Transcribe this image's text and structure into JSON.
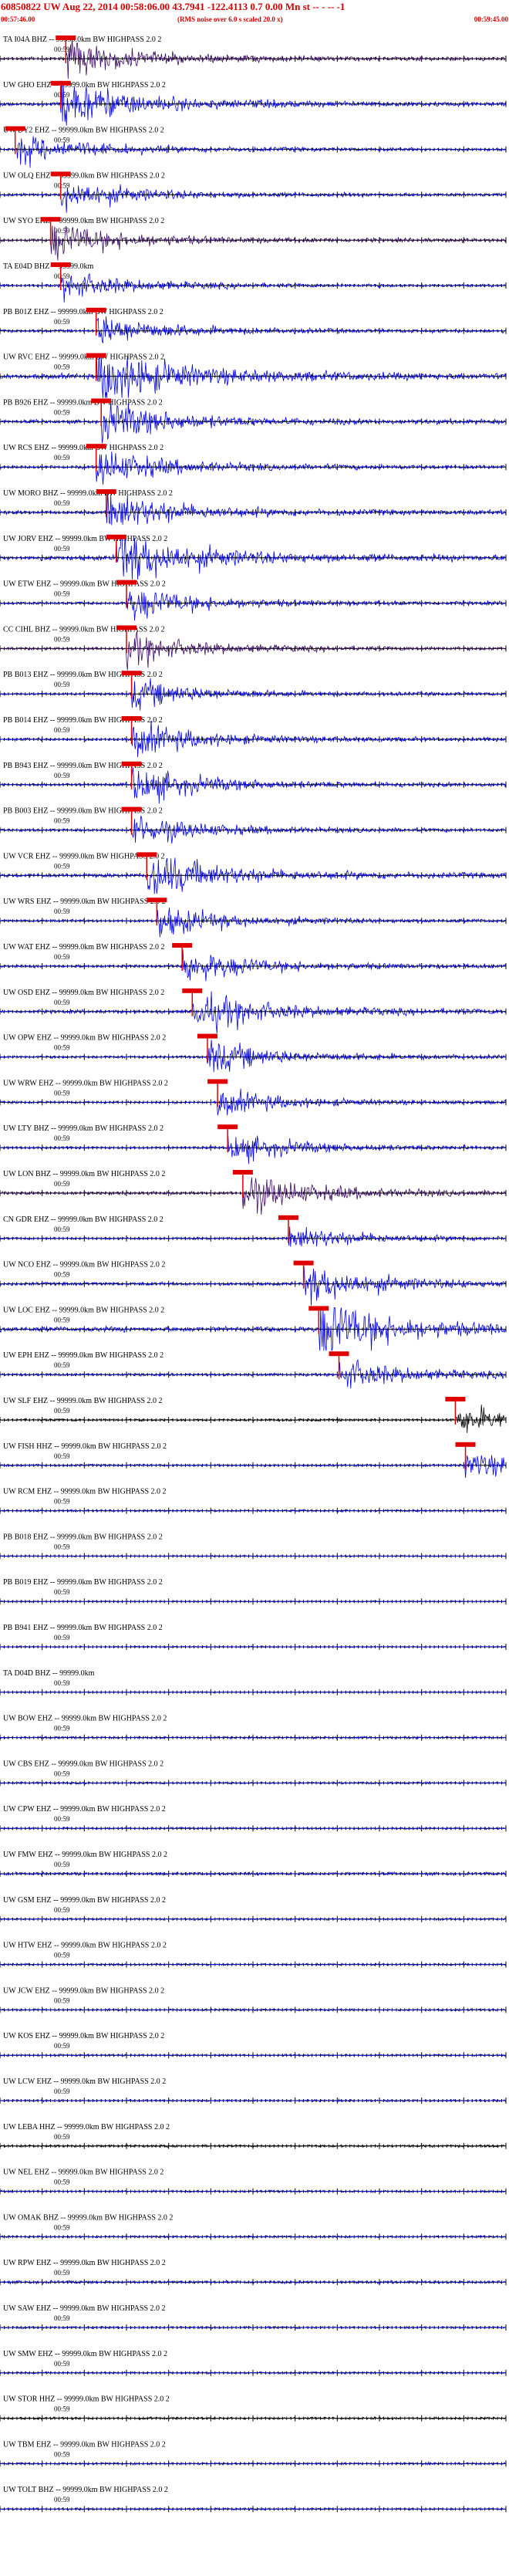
{
  "header": {
    "title": "60850822 UW Aug 22, 2014 00:58:06.00   43.7941 -122.4113  0.7 0.00 Mn st -- - -- -1",
    "start_time": "00:57:46.00",
    "note": "(RMS noise over 6.0 s scaled 20.0 x)",
    "end_time": "00:59:45.00"
  },
  "colors": {
    "red": "#d40000",
    "pick": "#e00000",
    "blue": "#0000ee",
    "purple": "#3a0a66",
    "black": "#000000"
  },
  "chart_data": {
    "type": "line",
    "title": "",
    "x": {
      "start": "00:57:46.00",
      "end": "00:59:45.00",
      "minute_mark": "00:59"
    },
    "traces": [
      {
        "label": "TA I04A BHZ -- 99999.0km BW  HIGHPASS  2.0  2",
        "color": "purple",
        "pick": 0.13,
        "energy": 1.4
      },
      {
        "label": "UW GHO EHZ -- 99999.0km BW  HIGHPASS  2.0  2",
        "color": "blue",
        "pick": 0.12,
        "energy": 1.8
      },
      {
        "label": "UW DY2 EHZ -- 99999.0km BW  HIGHPASS  2.0  2",
        "color": "blue",
        "pick": 0.03,
        "energy": 1.2
      },
      {
        "label": "UW OLQ EHZ -- 99999.0km BW  HIGHPASS  2.0  2",
        "color": "blue",
        "pick": 0.12,
        "energy": 1.2
      },
      {
        "label": "UW SYO EHZ -- 99999.0km BW  HIGHPASS  2.0  2",
        "color": "purple",
        "pick": 0.1,
        "energy": 1.4
      },
      {
        "label": "TA E04D BHZ -- 99999.0km",
        "color": "blue",
        "pick": 0.12,
        "energy": 1.1
      },
      {
        "label": "PB B01Z EHZ -- 99999.0km BW  HIGHPASS  2.0  2",
        "color": "blue",
        "pick": 0.19,
        "energy": 1.2
      },
      {
        "label": "UW RVC EHZ -- 99999.0km BW  HIGHPASS  2.0  2",
        "color": "blue",
        "pick": 0.19,
        "energy": 2.4
      },
      {
        "label": "PB B926 EHZ -- 99999.0km BW  HIGHPASS  2.0  2",
        "color": "blue",
        "pick": 0.2,
        "energy": 1.6
      },
      {
        "label": "UW RCS EHZ -- 99999.0km BW  HIGHPASS  2.0  2",
        "color": "blue",
        "pick": 0.19,
        "energy": 1.4
      },
      {
        "label": "UW MORO BHZ -- 99999.0km BW  HIGHPASS  2.0  2",
        "color": "blue",
        "pick": 0.21,
        "energy": 1.6
      },
      {
        "label": "UW JORV EHZ -- 99999.0km BW  HIGHPASS  2.0  2",
        "color": "blue",
        "pick": 0.23,
        "energy": 2.2
      },
      {
        "label": "UW ETW EHZ -- 99999.0km BW  HIGHPASS  2.0  2",
        "color": "blue",
        "pick": 0.25,
        "energy": 1.3
      },
      {
        "label": "CC CIHL BHZ -- 99999.0km BW  HIGHPASS  2.0  2",
        "color": "purple",
        "pick": 0.25,
        "energy": 1.2
      },
      {
        "label": "PB B013 EHZ -- 99999.0km BW  HIGHPASS  2.0  2",
        "color": "blue",
        "pick": 0.26,
        "energy": 1.1
      },
      {
        "label": "PB B014 EHZ -- 99999.0km BW  HIGHPASS  2.0  2",
        "color": "blue",
        "pick": 0.26,
        "energy": 1.3
      },
      {
        "label": "PB B943 EHZ -- 99999.0km BW  HIGHPASS  2.0  2",
        "color": "blue",
        "pick": 0.26,
        "energy": 1.4
      },
      {
        "label": "PB B003 EHZ -- 99999.0km BW  HIGHPASS  2.0  2",
        "color": "blue",
        "pick": 0.26,
        "energy": 1.2
      },
      {
        "label": "UW VCR EHZ -- 99999.0km BW  HIGHPASS  2.0  2",
        "color": "blue",
        "pick": 0.29,
        "energy": 1.8
      },
      {
        "label": "UW WRS EHZ -- 99999.0km BW  HIGHPASS  2.0  2",
        "color": "blue",
        "pick": 0.31,
        "energy": 1.2
      },
      {
        "label": "UW WAT EHZ -- 99999.0km BW  HIGHPASS  2.0  2",
        "color": "blue",
        "pick": 0.36,
        "energy": 1.3
      },
      {
        "label": "UW OSD EHZ -- 99999.0km BW  HIGHPASS  2.0  2",
        "color": "blue",
        "pick": 0.38,
        "energy": 1.6
      },
      {
        "label": "UW OPW EHZ -- 99999.0km BW  HIGHPASS  2.0  2",
        "color": "blue",
        "pick": 0.41,
        "energy": 1.2
      },
      {
        "label": "UW WRW EHZ -- 99999.0km BW  HIGHPASS  2.0  2",
        "color": "blue",
        "pick": 0.43,
        "energy": 1.0
      },
      {
        "label": "UW LTY BHZ -- 99999.0km BW  HIGHPASS  2.0  2",
        "color": "blue",
        "pick": 0.45,
        "energy": 1.1
      },
      {
        "label": "UW LON BHZ -- 99999.0km BW  HIGHPASS  2.0  2",
        "color": "purple",
        "pick": 0.48,
        "energy": 1.5
      },
      {
        "label": "CN GDR EHZ -- 99999.0km BW  HIGHPASS  2.0  2",
        "color": "blue",
        "pick": 0.57,
        "energy": 1.0
      },
      {
        "label": "UW NCO EHZ -- 99999.0km BW  HIGHPASS  2.0  2",
        "color": "blue",
        "pick": 0.6,
        "energy": 1.5
      },
      {
        "label": "UW LOC EHZ -- 99999.0km BW  HIGHPASS  2.0  2",
        "color": "blue",
        "pick": 0.63,
        "energy": 2.4
      },
      {
        "label": "UW EPH EHZ -- 99999.0km BW  HIGHPASS  2.0  2",
        "color": "blue",
        "pick": 0.67,
        "energy": 1.2
      },
      {
        "label": "UW SLF EHZ -- 99999.0km BW  HIGHPASS  2.0  2",
        "color": "black",
        "pick": 0.9,
        "energy": 1.1
      },
      {
        "label": "UW FISH HHZ -- 99999.0km BW  HIGHPASS  2.0  2",
        "color": "blue",
        "pick": 0.92,
        "energy": 1.0
      },
      {
        "label": "UW RCM EHZ -- 99999.0km BW  HIGHPASS  2.0  2",
        "color": "blue",
        "pick": null,
        "energy": 0.9
      },
      {
        "label": "PB B018 EHZ -- 99999.0km BW  HIGHPASS  2.0  2",
        "color": "blue",
        "pick": null,
        "energy": 0.6
      },
      {
        "label": "PB B019 EHZ -- 99999.0km BW  HIGHPASS  2.0  2",
        "color": "blue",
        "pick": null,
        "energy": 0.6
      },
      {
        "label": "PB B941 EHZ -- 99999.0km BW  HIGHPASS  2.0  2",
        "color": "blue",
        "pick": null,
        "energy": 0.6
      },
      {
        "label": "TA D04D BHZ -- 99999.0km",
        "color": "blue",
        "pick": null,
        "energy": 0.5
      },
      {
        "label": "UW BOW EHZ -- 99999.0km BW  HIGHPASS  2.0  2",
        "color": "blue",
        "pick": null,
        "energy": 1.0
      },
      {
        "label": "UW CBS EHZ -- 99999.0km BW  HIGHPASS  2.0  2",
        "color": "blue",
        "pick": null,
        "energy": 0.9
      },
      {
        "label": "UW CPW EHZ -- 99999.0km BW  HIGHPASS  2.0  2",
        "color": "blue",
        "pick": null,
        "energy": 0.9
      },
      {
        "label": "UW FMW EHZ -- 99999.0km BW  HIGHPASS  2.0  2",
        "color": "blue",
        "pick": null,
        "energy": 1.3
      },
      {
        "label": "UW GSM EHZ -- 99999.0km BW  HIGHPASS  2.0  2",
        "color": "blue",
        "pick": null,
        "energy": 0.9
      },
      {
        "label": "UW HTW EHZ -- 99999.0km BW  HIGHPASS  2.0  2",
        "color": "blue",
        "pick": null,
        "energy": 0.9
      },
      {
        "label": "UW JCW EHZ -- 99999.0km BW  HIGHPASS  2.0  2",
        "color": "blue",
        "pick": null,
        "energy": 0.9
      },
      {
        "label": "UW KOS EHZ -- 99999.0km BW  HIGHPASS  2.0  2",
        "color": "blue",
        "pick": null,
        "energy": 0.9
      },
      {
        "label": "UW LCW EHZ -- 99999.0km BW  HIGHPASS  2.0  2",
        "color": "blue",
        "pick": null,
        "energy": 0.9
      },
      {
        "label": "UW LEBA HHZ -- 99999.0km BW  HIGHPASS  2.0  2",
        "color": "black",
        "pick": null,
        "energy": 1.0
      },
      {
        "label": "UW NEL EHZ -- 99999.0km BW  HIGHPASS  2.0  2",
        "color": "blue",
        "pick": null,
        "energy": 0.9
      },
      {
        "label": "UW OMAK BHZ -- 99999.0km BW  HIGHPASS  2.0  2",
        "color": "blue",
        "pick": null,
        "energy": 0.9
      },
      {
        "label": "UW RPW EHZ -- 99999.0km BW  HIGHPASS  2.0  2",
        "color": "blue",
        "pick": null,
        "energy": 1.3
      },
      {
        "label": "UW SAW EHZ -- 99999.0km BW  HIGHPASS  2.0  2",
        "color": "blue",
        "pick": null,
        "energy": 0.9
      },
      {
        "label": "UW SMW EHZ -- 99999.0km BW  HIGHPASS  2.0  2",
        "color": "blue",
        "pick": null,
        "energy": 0.9
      },
      {
        "label": "UW STOR HHZ -- 99999.0km BW  HIGHPASS  2.0  2",
        "color": "black",
        "pick": null,
        "energy": 1.0
      },
      {
        "label": "UW TBM EHZ -- 99999.0km BW  HIGHPASS  2.0  2",
        "color": "blue",
        "pick": null,
        "energy": 0.9
      },
      {
        "label": "UW TOLT BHZ -- 99999.0km BW  HIGHPASS  2.0  2",
        "color": "blue",
        "pick": null,
        "energy": 0.9
      }
    ]
  }
}
